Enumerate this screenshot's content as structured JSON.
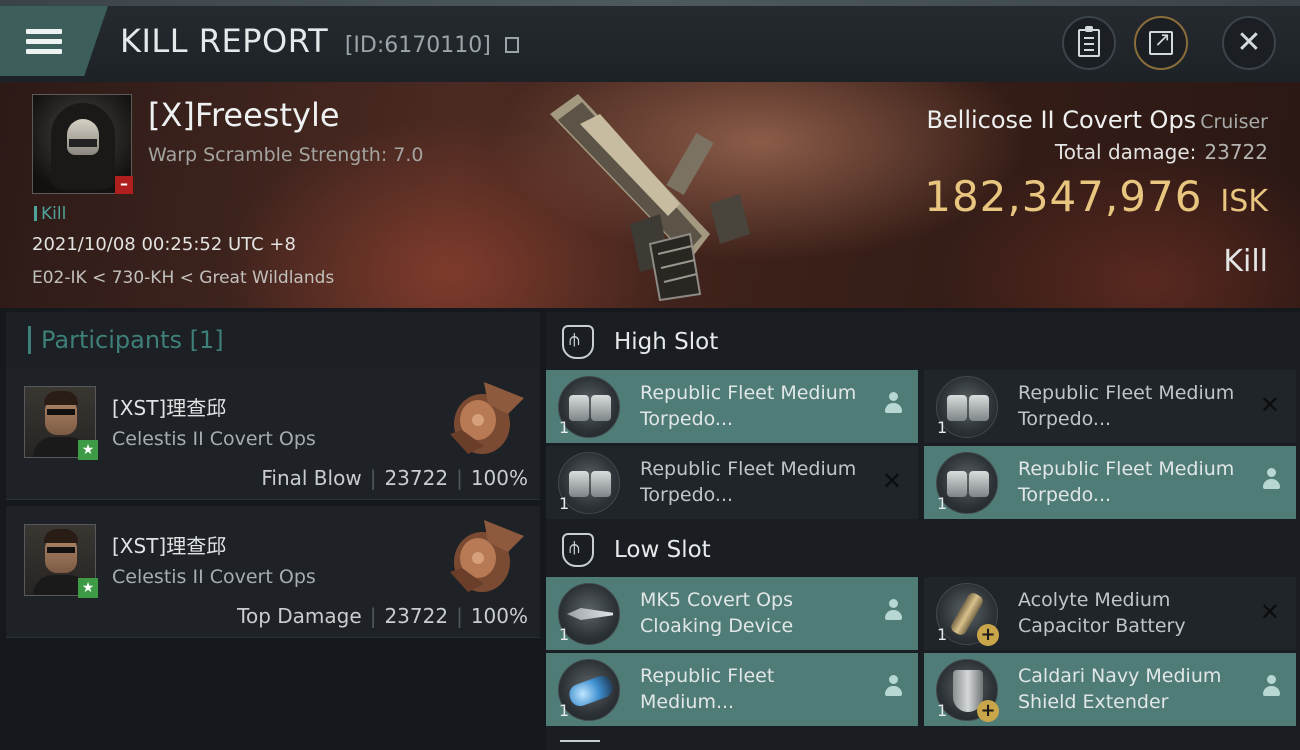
{
  "header": {
    "title": "KILL REPORT",
    "id": "[ID:6170110]",
    "menu_icon": "hamburger-icon",
    "buttons": [
      "clipboard-icon",
      "share-icon",
      "close-icon"
    ],
    "close_glyph": "✕"
  },
  "victim": {
    "name": "[X]Freestyle",
    "warp_scramble": "Warp Scramble Strength: 7.0",
    "status_tag": "Kill",
    "datetime": "2021/10/08 00:25:52 UTC +8",
    "location": "E02-IK < 730-KH < Great Wildlands",
    "security_badge": "–",
    "ship_name": "Bellicose II Covert Ops",
    "ship_class": "Cruiser",
    "total_damage_label": "Total damage:",
    "total_damage_value": "23722",
    "isk_amount": "182,347,976",
    "isk_unit": "ISK",
    "result": "Kill"
  },
  "participants": {
    "header": "Participants [1]",
    "items": [
      {
        "name": "[XST]理查邱",
        "ship": "Celestis II Covert Ops",
        "role": "Final Blow",
        "damage": "23722",
        "percent": "100%",
        "badge": "★"
      },
      {
        "name": "[XST]理查邱",
        "ship": "Celestis II Covert Ops",
        "role": "Top Damage",
        "damage": "23722",
        "percent": "100%",
        "badge": "★"
      }
    ]
  },
  "fitting": {
    "high_slot": {
      "label": "High Slot",
      "modules": [
        {
          "name": "Republic Fleet Medium Torpedo...",
          "qty": "1",
          "state": "equipped",
          "status": "person"
        },
        {
          "name": "Republic Fleet Medium Torpedo...",
          "qty": "1",
          "state": "empty",
          "status": "x"
        },
        {
          "name": "Republic Fleet Medium Torpedo...",
          "qty": "1",
          "state": "empty",
          "status": "x"
        },
        {
          "name": "Republic Fleet Medium Torpedo...",
          "qty": "1",
          "state": "equipped",
          "status": "person"
        }
      ]
    },
    "low_slot": {
      "label": "Low Slot",
      "modules": [
        {
          "name": "MK5 Covert Ops Cloaking Device",
          "qty": "1",
          "state": "equipped",
          "status": "person"
        },
        {
          "name": "Acolyte Medium Capacitor Battery",
          "qty": "1",
          "state": "empty",
          "status": "x"
        },
        {
          "name": "Republic Fleet Medium...",
          "qty": "1",
          "state": "equipped",
          "status": "person"
        },
        {
          "name": "Caldari Navy Medium Shield Extender",
          "qty": "1",
          "state": "equipped",
          "status": "person"
        }
      ]
    },
    "x_glyph": "✕",
    "plus_glyph": "+"
  },
  "colors": {
    "accent_teal": "#4f7c77",
    "isk_gold": "#e8c680",
    "badge_red": "#b01e1e",
    "badge_green": "#3d9a45"
  }
}
